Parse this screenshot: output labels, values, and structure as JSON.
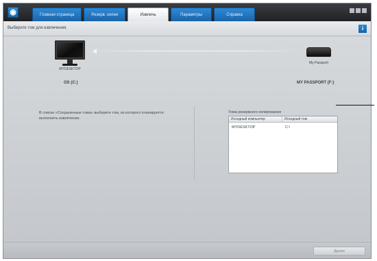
{
  "tabs": [
    {
      "label": "Главная страница"
    },
    {
      "label": "Резерв. копия"
    },
    {
      "label": "Извлечь"
    },
    {
      "label": "Параметры"
    },
    {
      "label": "Справка"
    }
  ],
  "active_tab_index": 2,
  "header": {
    "instruction": "Выберите том для извлечения.",
    "help_icon": "i"
  },
  "devices": {
    "computer": {
      "name": "MYDESKTOP",
      "volume": "OS (C:)",
      "icon": "monitor-icon"
    },
    "drive": {
      "name": "My Passport",
      "volume": "MY PASSPORT (F:)",
      "icon": "external-drive-icon"
    }
  },
  "description": "В списке «Сохраненные тома» выберите том, из которого планируется выполнить извлечение.",
  "backup_panel": {
    "title": "Тома резервного копирования",
    "columns": [
      "Исходный компьютер",
      "Исходный том"
    ],
    "rows": [
      [
        "MYDESKTOP",
        "C:\\"
      ]
    ]
  },
  "footer": {
    "next_label": "Далее",
    "next_enabled": false
  },
  "colors": {
    "tab_blue": "#1f6fb8",
    "title_bar": "#2a2d31",
    "content_bg": "#cdd0d3"
  }
}
